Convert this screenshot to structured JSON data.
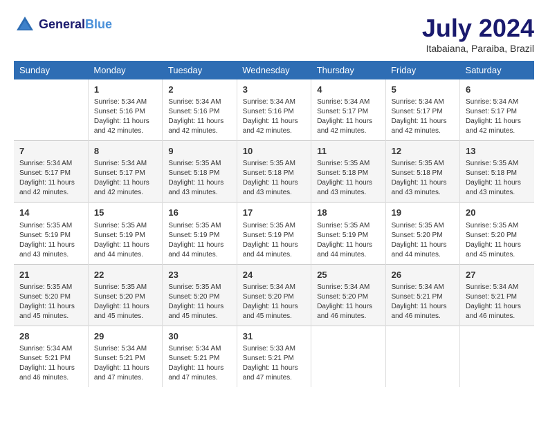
{
  "header": {
    "logo_line1": "General",
    "logo_line2": "Blue",
    "month_title": "July 2024",
    "location": "Itabaiana, Paraiba, Brazil"
  },
  "columns": [
    "Sunday",
    "Monday",
    "Tuesday",
    "Wednesday",
    "Thursday",
    "Friday",
    "Saturday"
  ],
  "weeks": [
    [
      {
        "day": "",
        "info": ""
      },
      {
        "day": "1",
        "info": "Sunrise: 5:34 AM\nSunset: 5:16 PM\nDaylight: 11 hours\nand 42 minutes."
      },
      {
        "day": "2",
        "info": "Sunrise: 5:34 AM\nSunset: 5:16 PM\nDaylight: 11 hours\nand 42 minutes."
      },
      {
        "day": "3",
        "info": "Sunrise: 5:34 AM\nSunset: 5:16 PM\nDaylight: 11 hours\nand 42 minutes."
      },
      {
        "day": "4",
        "info": "Sunrise: 5:34 AM\nSunset: 5:17 PM\nDaylight: 11 hours\nand 42 minutes."
      },
      {
        "day": "5",
        "info": "Sunrise: 5:34 AM\nSunset: 5:17 PM\nDaylight: 11 hours\nand 42 minutes."
      },
      {
        "day": "6",
        "info": "Sunrise: 5:34 AM\nSunset: 5:17 PM\nDaylight: 11 hours\nand 42 minutes."
      }
    ],
    [
      {
        "day": "7",
        "info": "Sunrise: 5:34 AM\nSunset: 5:17 PM\nDaylight: 11 hours\nand 42 minutes."
      },
      {
        "day": "8",
        "info": "Sunrise: 5:34 AM\nSunset: 5:17 PM\nDaylight: 11 hours\nand 42 minutes."
      },
      {
        "day": "9",
        "info": "Sunrise: 5:35 AM\nSunset: 5:18 PM\nDaylight: 11 hours\nand 43 minutes."
      },
      {
        "day": "10",
        "info": "Sunrise: 5:35 AM\nSunset: 5:18 PM\nDaylight: 11 hours\nand 43 minutes."
      },
      {
        "day": "11",
        "info": "Sunrise: 5:35 AM\nSunset: 5:18 PM\nDaylight: 11 hours\nand 43 minutes."
      },
      {
        "day": "12",
        "info": "Sunrise: 5:35 AM\nSunset: 5:18 PM\nDaylight: 11 hours\nand 43 minutes."
      },
      {
        "day": "13",
        "info": "Sunrise: 5:35 AM\nSunset: 5:18 PM\nDaylight: 11 hours\nand 43 minutes."
      }
    ],
    [
      {
        "day": "14",
        "info": "Sunrise: 5:35 AM\nSunset: 5:19 PM\nDaylight: 11 hours\nand 43 minutes."
      },
      {
        "day": "15",
        "info": "Sunrise: 5:35 AM\nSunset: 5:19 PM\nDaylight: 11 hours\nand 44 minutes."
      },
      {
        "day": "16",
        "info": "Sunrise: 5:35 AM\nSunset: 5:19 PM\nDaylight: 11 hours\nand 44 minutes."
      },
      {
        "day": "17",
        "info": "Sunrise: 5:35 AM\nSunset: 5:19 PM\nDaylight: 11 hours\nand 44 minutes."
      },
      {
        "day": "18",
        "info": "Sunrise: 5:35 AM\nSunset: 5:19 PM\nDaylight: 11 hours\nand 44 minutes."
      },
      {
        "day": "19",
        "info": "Sunrise: 5:35 AM\nSunset: 5:20 PM\nDaylight: 11 hours\nand 44 minutes."
      },
      {
        "day": "20",
        "info": "Sunrise: 5:35 AM\nSunset: 5:20 PM\nDaylight: 11 hours\nand 45 minutes."
      }
    ],
    [
      {
        "day": "21",
        "info": "Sunrise: 5:35 AM\nSunset: 5:20 PM\nDaylight: 11 hours\nand 45 minutes."
      },
      {
        "day": "22",
        "info": "Sunrise: 5:35 AM\nSunset: 5:20 PM\nDaylight: 11 hours\nand 45 minutes."
      },
      {
        "day": "23",
        "info": "Sunrise: 5:35 AM\nSunset: 5:20 PM\nDaylight: 11 hours\nand 45 minutes."
      },
      {
        "day": "24",
        "info": "Sunrise: 5:34 AM\nSunset: 5:20 PM\nDaylight: 11 hours\nand 45 minutes."
      },
      {
        "day": "25",
        "info": "Sunrise: 5:34 AM\nSunset: 5:20 PM\nDaylight: 11 hours\nand 46 minutes."
      },
      {
        "day": "26",
        "info": "Sunrise: 5:34 AM\nSunset: 5:21 PM\nDaylight: 11 hours\nand 46 minutes."
      },
      {
        "day": "27",
        "info": "Sunrise: 5:34 AM\nSunset: 5:21 PM\nDaylight: 11 hours\nand 46 minutes."
      }
    ],
    [
      {
        "day": "28",
        "info": "Sunrise: 5:34 AM\nSunset: 5:21 PM\nDaylight: 11 hours\nand 46 minutes."
      },
      {
        "day": "29",
        "info": "Sunrise: 5:34 AM\nSunset: 5:21 PM\nDaylight: 11 hours\nand 47 minutes."
      },
      {
        "day": "30",
        "info": "Sunrise: 5:34 AM\nSunset: 5:21 PM\nDaylight: 11 hours\nand 47 minutes."
      },
      {
        "day": "31",
        "info": "Sunrise: 5:33 AM\nSunset: 5:21 PM\nDaylight: 11 hours\nand 47 minutes."
      },
      {
        "day": "",
        "info": ""
      },
      {
        "day": "",
        "info": ""
      },
      {
        "day": "",
        "info": ""
      }
    ]
  ]
}
